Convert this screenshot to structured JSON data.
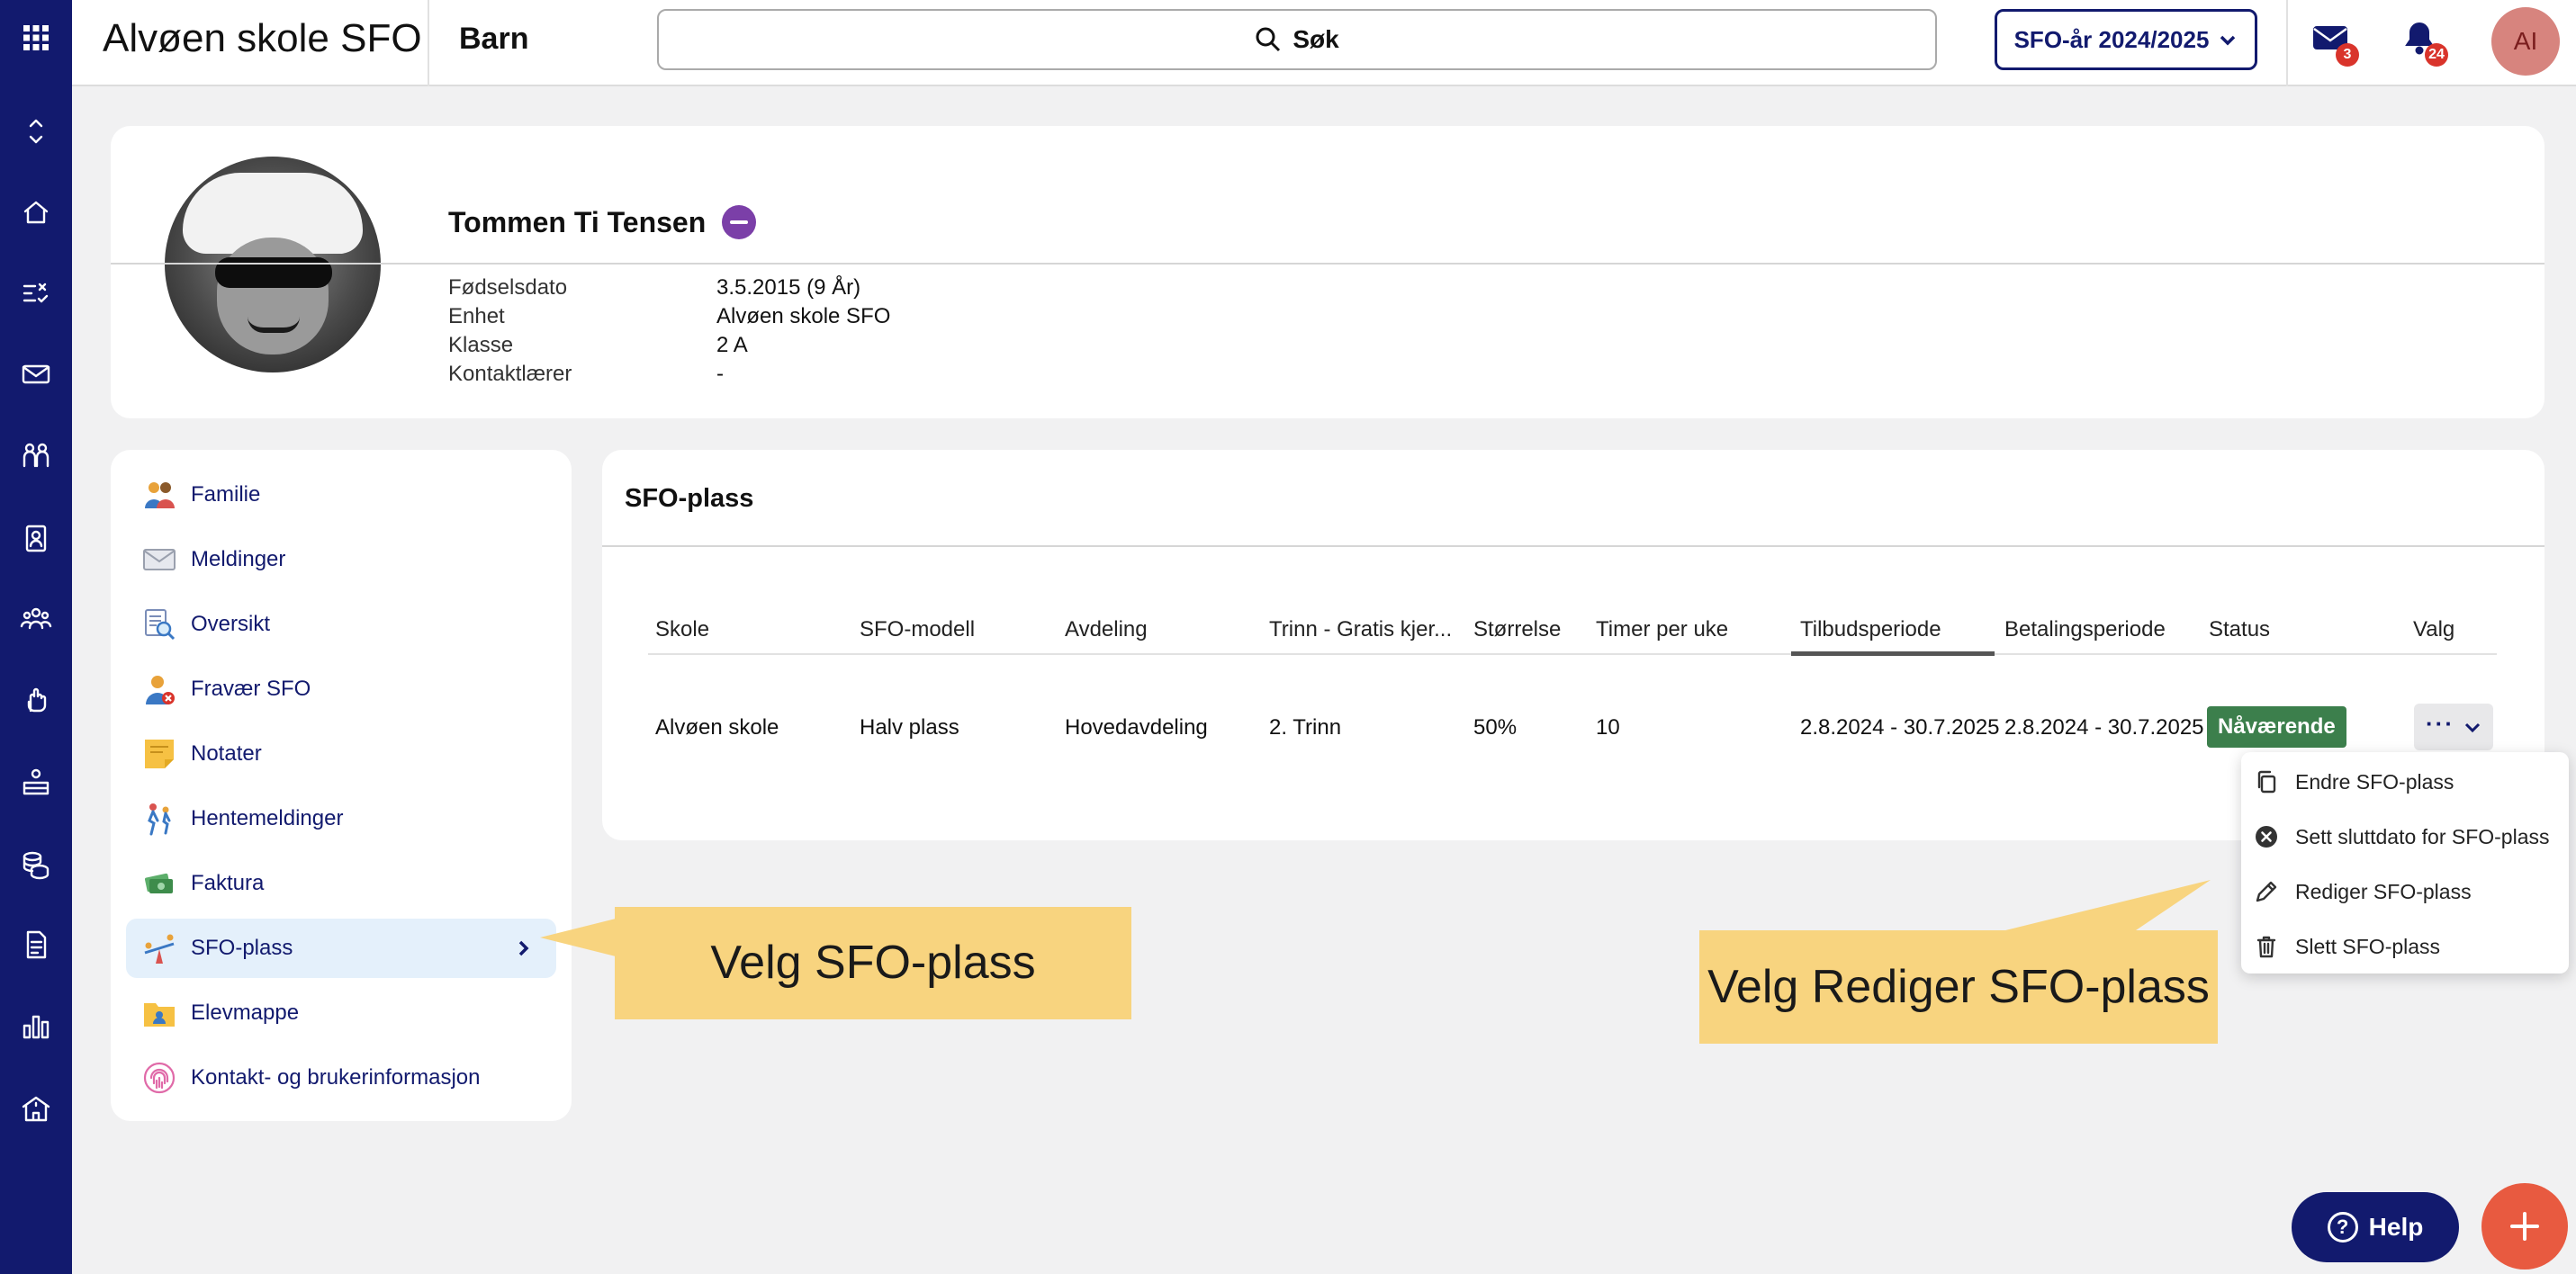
{
  "app": {
    "title": "Alvøen skole SFO",
    "section": "Barn"
  },
  "search": {
    "label": "Søk"
  },
  "year_select": {
    "label": "SFO-år 2024/2025"
  },
  "notifications": {
    "messages_count": "3",
    "alerts_count": "24"
  },
  "user": {
    "initials": "AI"
  },
  "student": {
    "name": "Tommen Ti Tensen",
    "fields": [
      {
        "label": "Fødselsdato",
        "value": "3.5.2015 (9 År)"
      },
      {
        "label": "Enhet",
        "value": "Alvøen skole SFO"
      },
      {
        "label": "Klasse",
        "value": "2 A"
      },
      {
        "label": "Kontaktlærer",
        "value": "-"
      }
    ]
  },
  "sidenav": {
    "items": [
      {
        "label": "Familie",
        "icon": "family-icon"
      },
      {
        "label": "Meldinger",
        "icon": "envelope-icon"
      },
      {
        "label": "Oversikt",
        "icon": "overview-icon"
      },
      {
        "label": "Fravær SFO",
        "icon": "absence-icon"
      },
      {
        "label": "Notater",
        "icon": "note-icon"
      },
      {
        "label": "Hentemeldinger",
        "icon": "pickup-icon"
      },
      {
        "label": "Faktura",
        "icon": "invoice-icon"
      },
      {
        "label": "SFO-plass",
        "icon": "seesaw-icon",
        "active": true
      },
      {
        "label": "Elevmappe",
        "icon": "folder-icon"
      },
      {
        "label": "Kontakt- og brukerinformasjon",
        "icon": "fingerprint-icon"
      }
    ]
  },
  "sfo": {
    "title": "SFO-plass",
    "columns": [
      "Skole",
      "SFO-modell",
      "Avdeling",
      "Trinn - Gratis kjer...",
      "Størrelse",
      "Timer per uke",
      "Tilbudsperiode",
      "Betalingsperiode",
      "Status",
      "Valg"
    ],
    "row": {
      "skole": "Alvøen skole",
      "modell": "Halv plass",
      "avdeling": "Hovedavdeling",
      "trinn": "2. Trinn",
      "storrelse": "50%",
      "timer": "10",
      "tilbudsperiode": "2.8.2024 - 30.7.2025",
      "betalingsperiode": "2.8.2024 - 30.7.2025",
      "status": "Nåværende",
      "status_color": "#3c7f4c"
    },
    "more_label": "···"
  },
  "menu": {
    "items": [
      {
        "label": "Endre SFO-plass",
        "icon": "copy-icon"
      },
      {
        "label": "Sett sluttdato for SFO-plass",
        "icon": "circle-x-icon"
      },
      {
        "label": "Rediger SFO-plass",
        "icon": "pencil-icon"
      },
      {
        "label": "Slett SFO-plass",
        "icon": "trash-icon"
      }
    ]
  },
  "callouts": {
    "left": "Velg SFO-plass",
    "right": "Velg Rediger SFO-plass"
  },
  "help": {
    "label": "Help"
  },
  "colors": {
    "rail": "#121a6e",
    "accent": "#121a6e",
    "callout": "#f8d47f",
    "fab": "#e85a40"
  }
}
